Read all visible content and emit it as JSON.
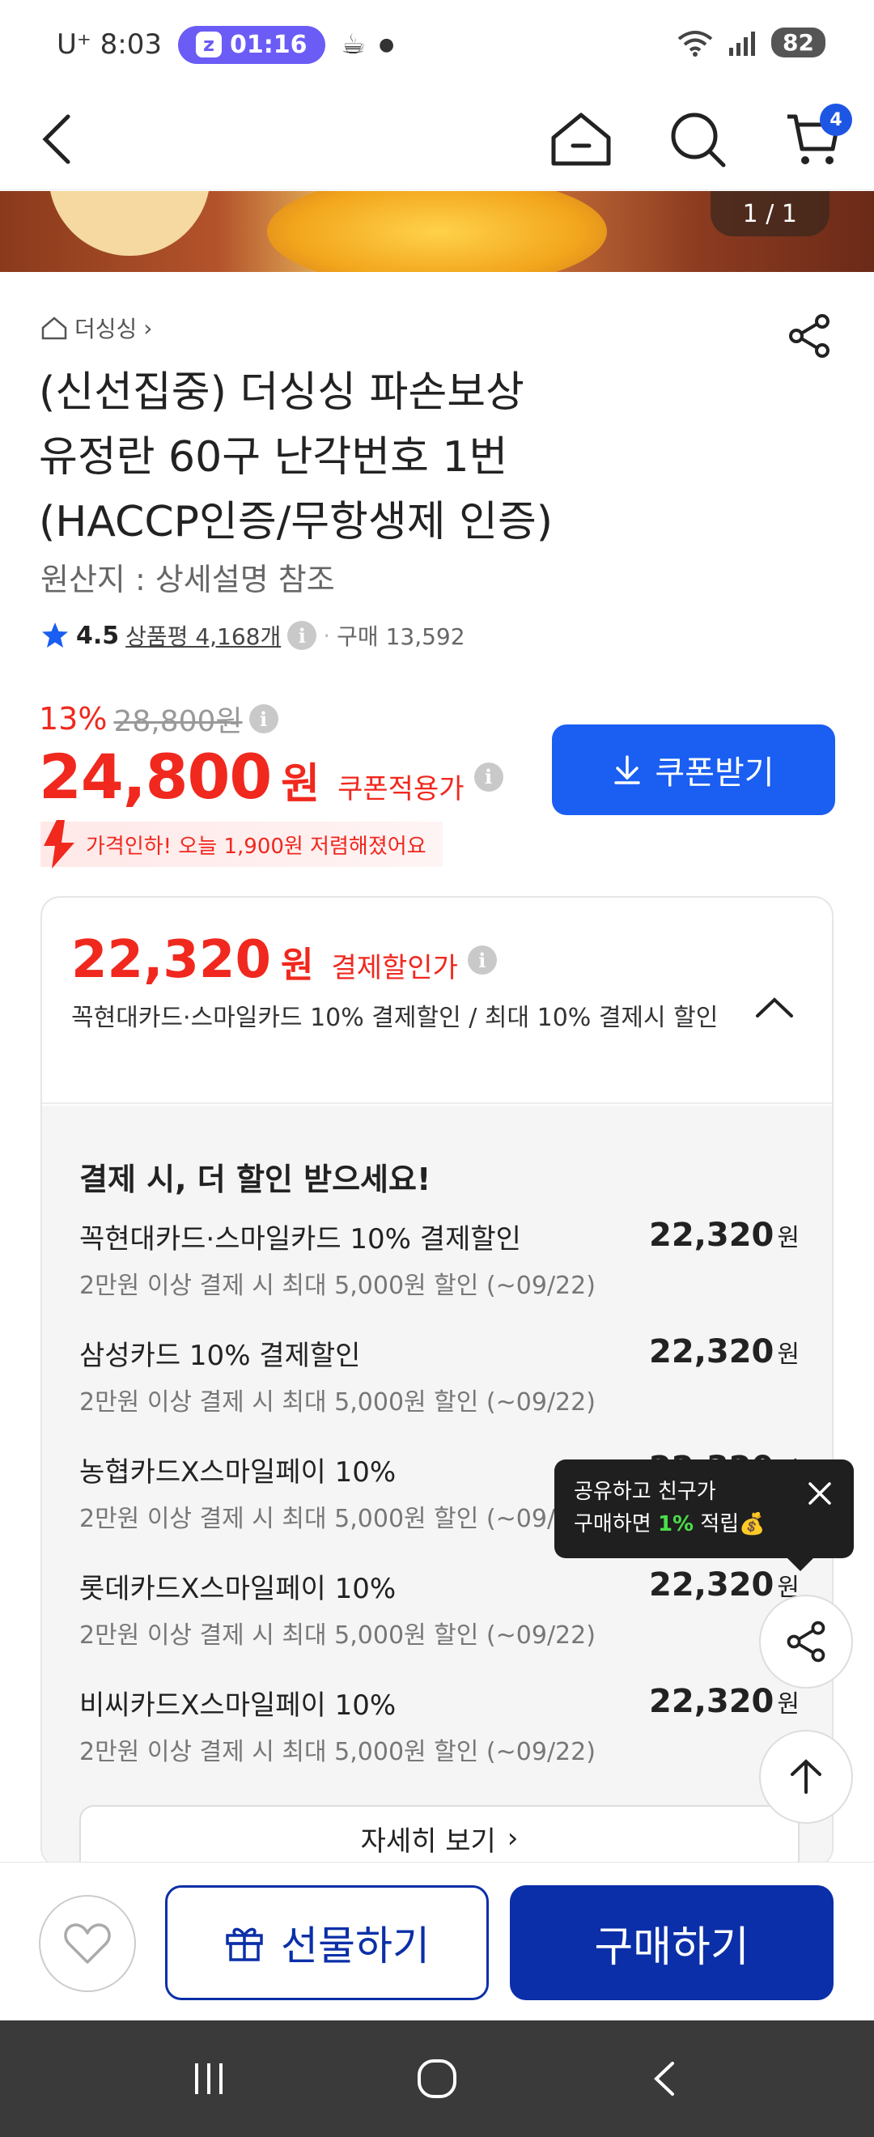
{
  "status_bar": {
    "carrier_time": "U⁺ 8:03",
    "alarm_time": "01:16",
    "battery": "82"
  },
  "header": {
    "cart_count": "4"
  },
  "hero": {
    "counter": "1 / 1"
  },
  "product": {
    "breadcrumb": "더싱싱",
    "title_line1": "(신선집중) 더싱싱 파손보상",
    "title_line2": "유정란 60구 난각번호 1번",
    "title_line3": "(HACCP인증/무항생제 인증)",
    "origin": "원산지 : 상세설명 참조",
    "rating": "4.5",
    "reviews": "상품평 4,168개",
    "purchases": "구매 13,592",
    "discount_rate": "13%",
    "original_price": "28,800원",
    "price": "24,800",
    "price_unit": "원",
    "price_label": "쿠폰적용가",
    "coupon_button": "쿠폰받기",
    "promo_text": "가격인하! 오늘 1,900원 저렴해졌어요"
  },
  "payment_card": {
    "price": "22,320",
    "price_unit": "원",
    "price_label": "결제할인가",
    "description": "꼭현대카드·스마일카드 10% 결제할인 / 최대 10% 결제시 할인",
    "section_title": "결제 시, 더 할인 받으세요!",
    "offers": [
      {
        "name": "꼭현대카드·스마일카드 10% 결제할인",
        "sub": "2만원 이상 결제 시 최대 5,000원 할인 (~09/22)",
        "amount": "22,320",
        "unit": "원"
      },
      {
        "name": "삼성카드 10% 결제할인",
        "sub": "2만원 이상 결제 시 최대 5,000원 할인 (~09/22)",
        "amount": "22,320",
        "unit": "원"
      },
      {
        "name": "농협카드X스마일페이 10%",
        "sub": "2만원 이상 결제 시 최대 5,000원 할인 (~09/22)",
        "amount": "22,320",
        "unit": "원"
      },
      {
        "name": "롯데카드X스마일페이 10%",
        "sub": "2만원 이상 결제 시 최대 5,000원 할인 (~09/22)",
        "amount": "22,320",
        "unit": "원"
      },
      {
        "name": "비씨카드X스마일페이 10%",
        "sub": "2만원 이상 결제 시 최대 5,000원 할인 (~09/22)",
        "amount": "22,320",
        "unit": "원"
      }
    ],
    "detail_button": "자세히 보기"
  },
  "tooltip": {
    "line1": "공유하고 친구가",
    "line2_prefix": "구매하면 ",
    "line2_highlight": "1%",
    "line2_suffix": " 적립💰"
  },
  "bottom_bar": {
    "gift_label": "선물하기",
    "buy_label": "구매하기"
  },
  "colors": {
    "price_red": "#f0281e",
    "coupon_blue": "#1a5ef2",
    "buy_navy": "#0b2fa8"
  }
}
